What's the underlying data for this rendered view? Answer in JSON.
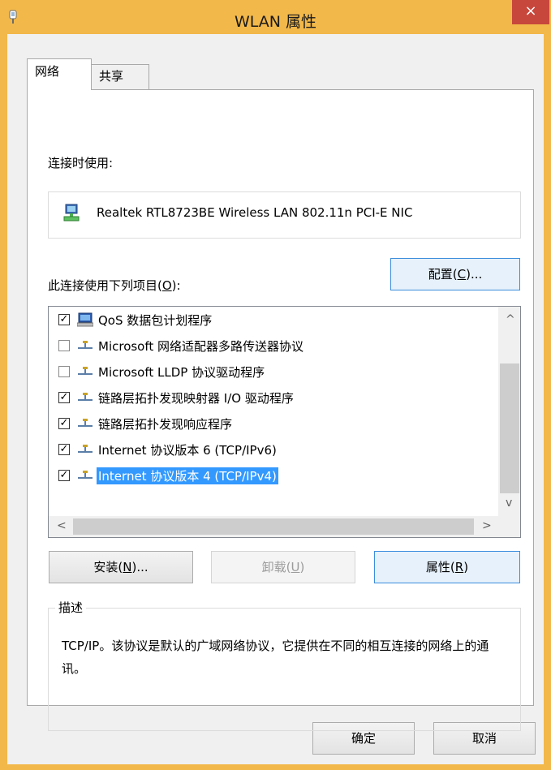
{
  "window": {
    "title": "WLAN 属性",
    "close_glyph": "×"
  },
  "tabs": [
    {
      "label": "网络",
      "active": true
    },
    {
      "label": "共享",
      "active": false
    }
  ],
  "connect_using": {
    "label": "连接时使用:",
    "adapter": "Realtek RTL8723BE Wireless LAN 802.11n PCI-E NIC",
    "configure_button": {
      "pre": "配置(",
      "key": "C",
      "post": ")..."
    }
  },
  "items_label": {
    "pre": "此连接使用下列项目(",
    "key": "O",
    "post": "):"
  },
  "items": [
    {
      "label": "QoS 数据包计划程序",
      "checked": true,
      "icon": "qos-scheduler-icon",
      "selected": false
    },
    {
      "label": "Microsoft 网络适配器多路传送器协议",
      "checked": false,
      "icon": "network-protocol-icon",
      "selected": false
    },
    {
      "label": "Microsoft LLDP 协议驱动程序",
      "checked": false,
      "icon": "network-protocol-icon",
      "selected": false
    },
    {
      "label": "链路层拓扑发现映射器 I/O 驱动程序",
      "checked": true,
      "icon": "network-protocol-icon",
      "selected": false
    },
    {
      "label": "链路层拓扑发现响应程序",
      "checked": true,
      "icon": "network-protocol-icon",
      "selected": false
    },
    {
      "label": "Internet 协议版本 6 (TCP/IPv6)",
      "checked": true,
      "icon": "network-protocol-icon",
      "selected": false
    },
    {
      "label": "Internet 协议版本 4 (TCP/IPv4)",
      "checked": true,
      "icon": "network-protocol-icon",
      "selected": true
    }
  ],
  "check_glyph": "✓",
  "scroll": {
    "up": "^",
    "down": "v",
    "left": "<",
    "right": ">"
  },
  "buttons": {
    "install": {
      "pre": "安装(",
      "key": "N",
      "post": ")..."
    },
    "uninstall": {
      "pre": "卸载(",
      "key": "U",
      "post": ")"
    },
    "properties": {
      "pre": "属性(",
      "key": "R",
      "post": ")"
    },
    "ok": "确定",
    "cancel": "取消"
  },
  "description": {
    "legend": "描述",
    "text": "TCP/IP。该协议是默认的广域网络协议，它提供在不同的相互连接的网络上的通讯。"
  },
  "colors": {
    "title_bar": "#f2b84a",
    "close_button": "#c8473c",
    "selection": "#3399ff",
    "focus_border": "#3c8ddc"
  }
}
